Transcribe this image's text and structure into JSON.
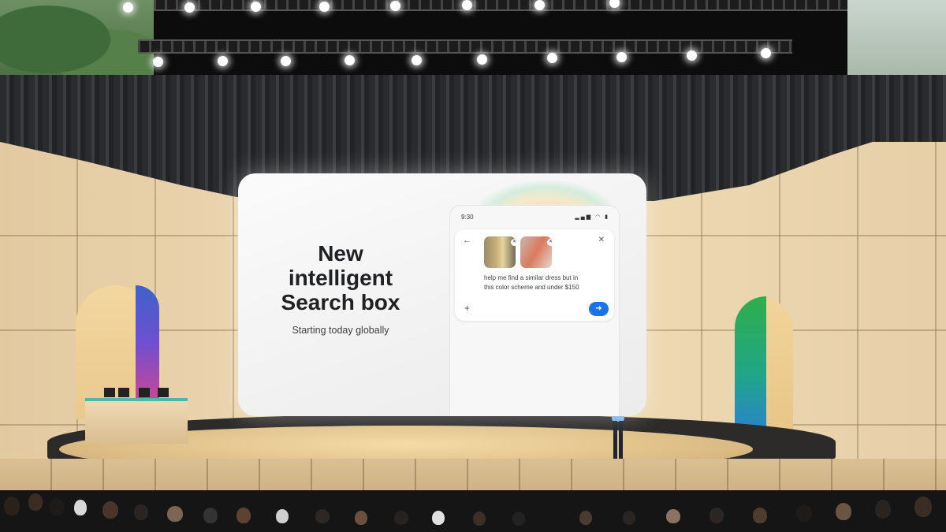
{
  "screen": {
    "headline": "New\nintelligent\nSearch box",
    "subheadline": "Starting today globally",
    "phone": {
      "time": "9:30",
      "status_icons": [
        "signal-icon",
        "wifi-icon",
        "battery-icon"
      ],
      "prompt": "help me find a similar dress but in\nthis color scheme and under $150",
      "send_icon": "arrow-right-icon",
      "send_color": "#1a73e8"
    }
  }
}
